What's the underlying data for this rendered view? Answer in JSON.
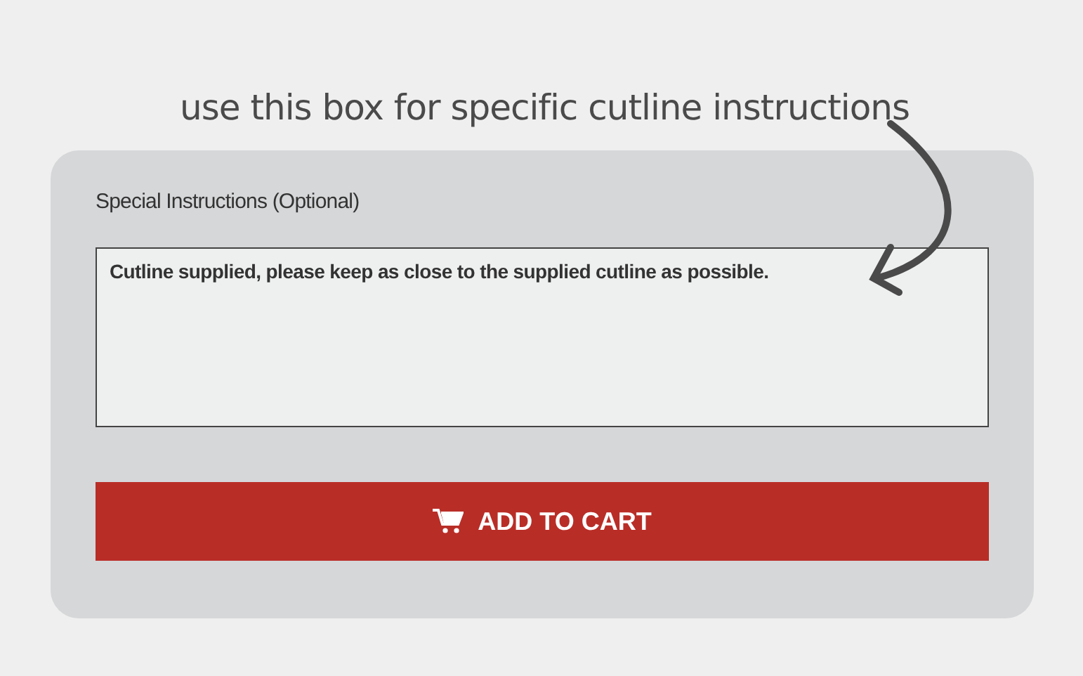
{
  "annotation": {
    "text": "use this box for specific cutline instructions"
  },
  "form": {
    "label": "Special Instructions (Optional)",
    "instructions": {
      "value": "Cutline supplied, please keep as close to the supplied cutline as possible."
    },
    "button": {
      "label": "ADD TO CART"
    }
  }
}
